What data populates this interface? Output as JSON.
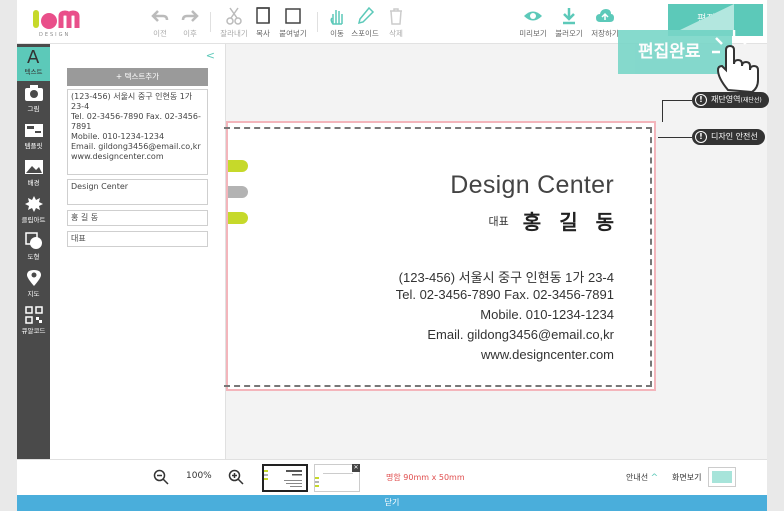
{
  "logo": {
    "brand": "Iam",
    "sub": "DESIGN"
  },
  "toolbar": {
    "undo": "이전",
    "redo": "이후",
    "cut": "잘라내기",
    "copy": "복사",
    "paste": "붙여넣기",
    "move": "이동",
    "eyedropper": "스포이드",
    "delete": "삭제",
    "preview": "미리보기",
    "load": "불러오기",
    "save": "저장하기",
    "edit_done": "편집완료"
  },
  "rail": {
    "items": [
      {
        "label": "텍스트",
        "icon": "text-icon"
      },
      {
        "label": "그림",
        "icon": "camera-icon"
      },
      {
        "label": "템플릿",
        "icon": "template-icon"
      },
      {
        "label": "배경",
        "icon": "image-icon"
      },
      {
        "label": "클립아트",
        "icon": "clipart-icon"
      },
      {
        "label": "도형",
        "icon": "shape-icon"
      },
      {
        "label": "지도",
        "icon": "map-pin-icon"
      },
      {
        "label": "큐알코드",
        "icon": "qr-code-icon"
      }
    ]
  },
  "panel": {
    "add_text": "+ 텍스트추가",
    "field_address": "(123-456) 서울시 중구 인현동 1가 23-4\nTel. 02-3456-7890  Fax. 02-3456-7891\nMobile. 010-1234-1234\nEmail. gildong3456@email.co,kr\nwww.designcenter.com",
    "field_company": "Design Center",
    "field_name": "홍 길 동",
    "field_role": "대표"
  },
  "card": {
    "company": "Design Center",
    "role": "대표",
    "name": "홍길동",
    "address": "(123-456) 서울시 중구 인현동 1가 23-4",
    "tel_fax": "Tel. 02-3456-7890   Fax. 02-3456-7891",
    "mobile": "Mobile. 010-1234-1234",
    "email": "Email. gildong3456@email.co,kr",
    "web": "www.designcenter.com",
    "colors": {
      "lime": "#c6d92a",
      "gray": "#b3b3b3",
      "bleed": "#f3b5bb"
    }
  },
  "tags": {
    "cut_area": "재단영역",
    "cut_area_small": "(재단선)",
    "design_safe": "디자인 안전선"
  },
  "bottom": {
    "zoom": "100%",
    "size": "명함 90mm x 50mm",
    "guide": "안내선",
    "screen_view": "화면보기",
    "close": "닫기"
  },
  "colors": {
    "accent": "#5cc9b9",
    "close_bar": "#4aaedb",
    "rail": "#4a4a4a"
  }
}
